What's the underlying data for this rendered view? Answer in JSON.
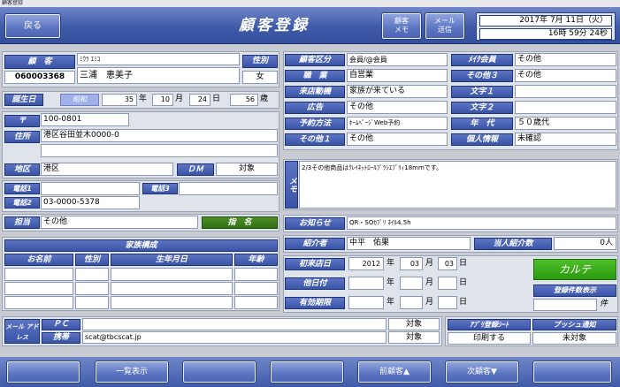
{
  "window": {
    "title": "顧客登録"
  },
  "header": {
    "back_label": "戻る",
    "title": "顧客登録",
    "memo_btn": "顧客\nメモ",
    "mail_btn": "メール\n送信",
    "date": "2017年 7月 11日（火）",
    "time": "16時 59分 24秒"
  },
  "customer": {
    "label": "顧　客",
    "kana": "ﾐｳﾗ ｴﾐｺ",
    "id": "060003368",
    "name": "三浦　恵美子",
    "sex_label": "性別",
    "sex": "女"
  },
  "birth": {
    "label": "誕生日",
    "era": "昭和",
    "year": "35",
    "year_unit": "年",
    "month": "10",
    "month_unit": "月",
    "day": "24",
    "day_unit": "日",
    "age": "56",
    "age_unit": "歳"
  },
  "address": {
    "zip_label": "〒",
    "zip": "100-0801",
    "addr_label": "住所",
    "addr1": "港区谷田並木0000-0",
    "addr2": "",
    "area_label": "地区",
    "area": "港区",
    "dm_label": "ＤＭ",
    "dm": "対象"
  },
  "phones": {
    "tel1_label": "電話1",
    "tel1": "",
    "tel3_label": "電話3",
    "tel3": "",
    "tel2_label": "電話2",
    "tel2": "03-0000-5378"
  },
  "staff": {
    "label": "担当",
    "value": "その他",
    "assign_label": "指　名"
  },
  "family": {
    "title": "家族構成",
    "headers": [
      "お名前",
      "性別",
      "生年月日",
      "年齢"
    ]
  },
  "mail": {
    "label": "メール アドレス",
    "pc_label": "ＰＣ",
    "pc": "",
    "pc_status": "対象",
    "mobile_label": "携帯",
    "mobile": "scat@tbcscat.jp",
    "mobile_status": "対象"
  },
  "attributes": {
    "kubun_label": "顧客区分",
    "kubun": "会員/@会員",
    "job_label": "職　業",
    "job": "自営業",
    "motive_label": "来店動機",
    "motive": "家族が来ている",
    "ad_label": "広告",
    "ad": "その他",
    "reserve_label": "予約方法",
    "reserve": "ﾎｰﾑﾍﾟｰｼﾞWeb予約",
    "other1_label": "その他１",
    "other1": "その他",
    "make_label": "ﾒｲｸ会員",
    "make": "その他",
    "other3_label": "その他３",
    "other3": "その他",
    "char1_label": "文字１",
    "char1": "",
    "char2_label": "文字２",
    "char2": "",
    "age_label": "年　代",
    "age": "５０歳代",
    "privacy_label": "個人情報",
    "privacy": "未確認"
  },
  "memo": {
    "label": "メモ",
    "text": "2/3その他商品はｸﾚｲﾈｯﾄﾛｰﾙﾌﾞﾗｼｴﾌﾞﾘｨ18mmです。"
  },
  "notice": {
    "label": "お知らせ",
    "value": "QR・SOｶﾌﾞﾘ ﾈｲﾙ4.5h"
  },
  "referral": {
    "label": "紹介者",
    "value": "中平　佑果",
    "count_label": "当人紹介数",
    "count": "0人"
  },
  "visit": {
    "first_label": "初来店日",
    "first_year": "2012",
    "first_month": "03",
    "first_day": "03",
    "other_label": "他日付",
    "valid_label": "有効期限",
    "year_unit": "年",
    "month_unit": "月",
    "day_unit": "日"
  },
  "karte": {
    "label": "カルテ",
    "reg_label": "登録件数表示",
    "reg_unit": "件",
    "reg_value": ""
  },
  "app": {
    "app_label": "ｱﾌﾟﾘ登録ｼｰﾄ",
    "push_label": "プッシュ通知",
    "print": "印刷する",
    "push": "未対象"
  },
  "footer": {
    "btn1": "",
    "list": "一覧表示",
    "btn3": "",
    "btn4": "",
    "prev": "前顧客▲",
    "next": "次顧客▼",
    "btn7": ""
  }
}
